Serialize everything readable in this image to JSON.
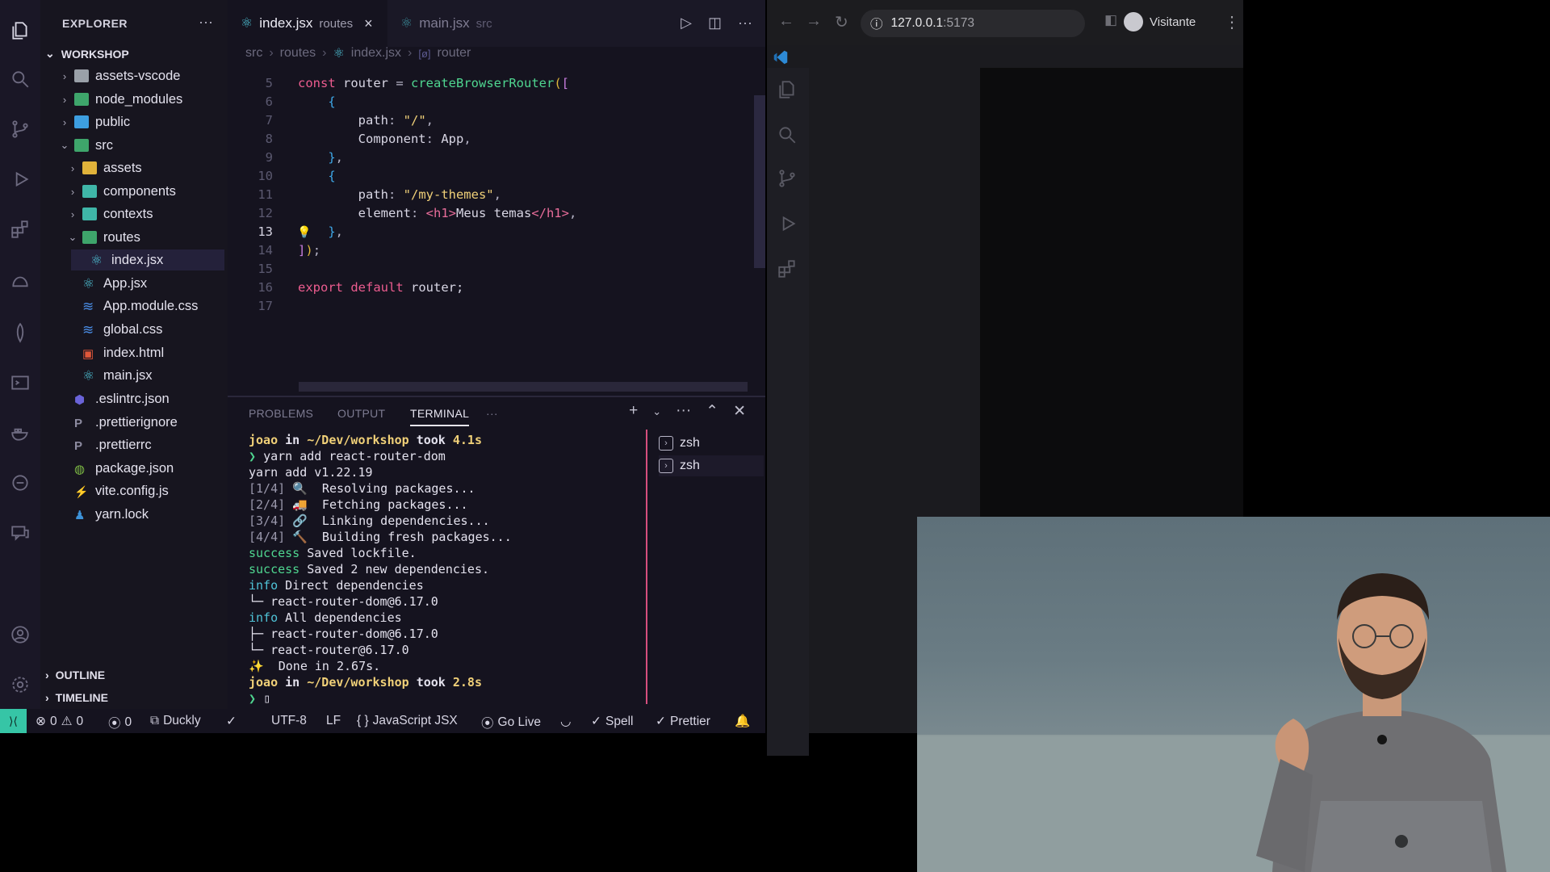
{
  "vscode": {
    "explorer": {
      "title": "EXPLORER",
      "more": "···",
      "workspace": "WORKSHOP",
      "tree": [
        {
          "label": "assets-vscode",
          "icon": "folder",
          "expanded": false
        },
        {
          "label": "node_modules",
          "icon": "folder-green",
          "expanded": false
        },
        {
          "label": "public",
          "icon": "folder-blue",
          "expanded": false
        },
        {
          "label": "src",
          "icon": "folder-green",
          "expanded": true
        },
        {
          "label": "assets",
          "icon": "folder-yellow",
          "expanded": false
        },
        {
          "label": "components",
          "icon": "folder-teal",
          "expanded": false
        },
        {
          "label": "contexts",
          "icon": "folder-teal",
          "expanded": false
        },
        {
          "label": "routes",
          "icon": "folder-green",
          "expanded": true
        },
        {
          "label": "index.jsx",
          "icon": "react"
        },
        {
          "label": "App.jsx",
          "icon": "react"
        },
        {
          "label": "App.module.css",
          "icon": "css"
        },
        {
          "label": "global.css",
          "icon": "css"
        },
        {
          "label": "index.html",
          "icon": "html"
        },
        {
          "label": "main.jsx",
          "icon": "react"
        },
        {
          "label": ".eslintrc.json",
          "icon": "eslint"
        },
        {
          "label": ".prettierignore",
          "icon": "prettier"
        },
        {
          "label": ".prettierrc",
          "icon": "prettier"
        },
        {
          "label": "package.json",
          "icon": "npm"
        },
        {
          "label": "vite.config.js",
          "icon": "vite"
        },
        {
          "label": "yarn.lock",
          "icon": "yarn"
        }
      ],
      "outline": "OUTLINE",
      "timeline": "TIMELINE"
    },
    "tabs": [
      {
        "name": "index.jsx",
        "sub": "routes",
        "active": true
      },
      {
        "name": "main.jsx",
        "sub": "src",
        "active": false
      }
    ],
    "breadcrumb": {
      "p1": "src",
      "p2": "routes",
      "p3": "index.jsx",
      "p4": "router"
    },
    "code": {
      "l4": "",
      "l5": "5",
      "l6": "6",
      "l7": "7",
      "l8": "8",
      "l9": "9",
      "l10": "10",
      "l11": "11",
      "l12": "12",
      "l13": "13",
      "l14": "14",
      "l15": "15",
      "l16": "16",
      "l17": "17",
      "const": "const",
      "router": "router",
      "eq": " = ",
      "create": "createBrowserRouter",
      "open": "([",
      "brace_open": "{",
      "path": "path",
      "colon": ": ",
      "slash": "\"/\"",
      "comma": ",",
      "component": "Component",
      "app": "App",
      "brace_close": "},",
      "themes": "\"/my-themes\"",
      "element": "element",
      "h1open": "<h1>",
      "h1text": "Meus temas",
      "h1close": "</h1>",
      "close": "]);",
      "export": "export",
      "default": "default",
      "router_end": "router;"
    },
    "panel": {
      "tabs": [
        "PROBLEMS",
        "OUTPUT",
        "TERMINAL"
      ],
      "active": "TERMINAL",
      "more": "···",
      "shells": [
        "zsh",
        "zsh"
      ],
      "terminal": [
        {
          "user": "joao",
          "in": " in ",
          "path": "~/Dev/workshop",
          "took": " took ",
          "time": "4.1s"
        },
        {
          "prompt": "❯ ",
          "cmd": "yarn add react-router-dom"
        },
        {
          "text": "yarn add v1.22.19"
        },
        {
          "step": "[1/4] ",
          "icon": "🔍",
          "text": "  Resolving packages..."
        },
        {
          "step": "[2/4] ",
          "icon": "🚚",
          "text": "  Fetching packages..."
        },
        {
          "step": "[3/4] ",
          "icon": "🔗",
          "text": "  Linking dependencies..."
        },
        {
          "step": "[4/4] ",
          "icon": "🔨",
          "text": "  Building fresh packages..."
        },
        {
          "tag": "success",
          "text": " Saved lockfile."
        },
        {
          "tag": "success",
          "text": " Saved 2 new dependencies."
        },
        {
          "tag": "info",
          "text": " Direct dependencies"
        },
        {
          "text": "└─ react-router-dom@6.17.0"
        },
        {
          "tag": "info",
          "text": " All dependencies"
        },
        {
          "text": "├─ react-router-dom@6.17.0"
        },
        {
          "text": "└─ react-router@6.17.0"
        },
        {
          "text": "✨  Done in 2.67s."
        },
        {
          "user": "joao",
          "in": " in ",
          "path": "~/Dev/workshop",
          "took": " took ",
          "time": "2.8s"
        },
        {
          "prompt": "❯ ",
          "cmd": "▯"
        }
      ]
    },
    "status": {
      "errors": "0",
      "warnings": "0",
      "ports": "0",
      "duckly": "Duckly",
      "encoding": "UTF-8",
      "eol": "LF",
      "language": "JavaScript JSX",
      "golive": "Go Live",
      "spell": "Spell",
      "prettier": "Prettier"
    }
  },
  "browser": {
    "url": "127.0.0.1",
    "port": ":5173",
    "profile": "Visitante"
  }
}
